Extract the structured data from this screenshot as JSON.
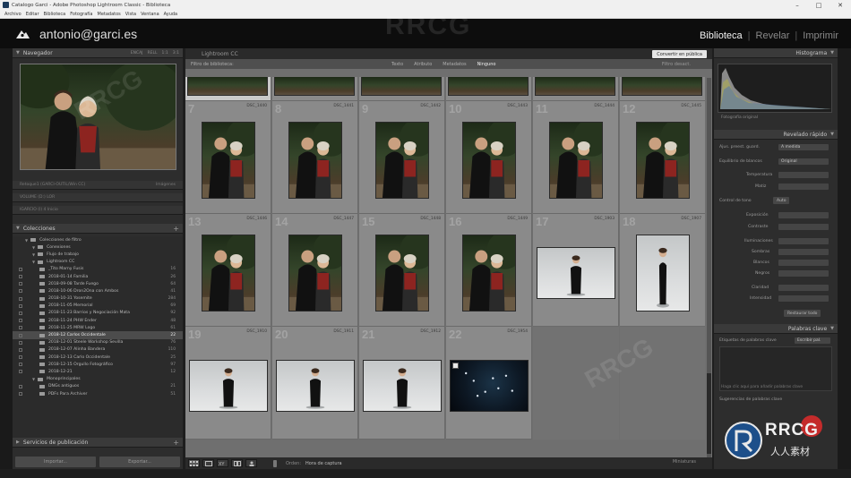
{
  "window": {
    "title": "Catalogo Garci - Adobe Photoshop Lightroom Classic - Biblioteca",
    "controls": [
      "minimize-icon",
      "maximize-icon",
      "close-icon"
    ]
  },
  "menu": [
    "Archivo",
    "Editar",
    "Biblioteca",
    "Fotografía",
    "Metadatos",
    "Vista",
    "Ventana",
    "Ayuda"
  ],
  "identity": {
    "user": "antonio@garci.es",
    "modules": [
      {
        "label": "Biblioteca",
        "active": true
      },
      {
        "label": "Revelar",
        "active": false
      },
      {
        "label": "Imprimir",
        "active": false
      }
    ]
  },
  "left_panel": {
    "navigator": {
      "title": "Navegador",
      "zoom_options": [
        "ENCAJ",
        "RELL",
        "1:1",
        "3:1"
      ]
    },
    "catalog_rows": [
      "Retoque1 (GARCI-OUTIL/Win CC)",
      "VOLUME (D:) LOR",
      "IGARCIO (I) 4 Inicio"
    ],
    "catalog_right": "Imágenes",
    "collections": {
      "title": "Colecciones",
      "items": [
        {
          "label": "Colecciones de filtro",
          "count": "",
          "indent": 1
        },
        {
          "label": "Conexiones",
          "count": "",
          "indent": 2
        },
        {
          "label": "Flujo de trabajo",
          "count": "",
          "indent": 2
        },
        {
          "label": "Lightroom CC",
          "count": "",
          "indent": 2
        },
        {
          "label": "_Tito Marny Fusis",
          "count": "16",
          "indent": 3
        },
        {
          "label": "2018-01-14 Familia",
          "count": "26",
          "indent": 3
        },
        {
          "label": "2018-09-08 Tarde Fuego",
          "count": "64",
          "indent": 3
        },
        {
          "label": "2018-10-06 Dron2Ona con Ambos",
          "count": "41",
          "indent": 3
        },
        {
          "label": "2018-10-31 Yosemite",
          "count": "284",
          "indent": 3
        },
        {
          "label": "2018-11-05 Memorial",
          "count": "69",
          "indent": 3
        },
        {
          "label": "2018-11-23 Barrios y Negociación Mata",
          "count": "92",
          "indent": 3
        },
        {
          "label": "2018-11-24 PHW Ender",
          "count": "48",
          "indent": 3
        },
        {
          "label": "2018-11-25 MRW Logo",
          "count": "61",
          "indent": 3
        },
        {
          "label": "2018-12 Carlos Occidentale",
          "count": "22",
          "indent": 3,
          "selected": true
        },
        {
          "label": "2018-12-01 Steele Workshop Sevilla",
          "count": "76",
          "indent": 3
        },
        {
          "label": "2018-12-07 Alinha Bandera",
          "count": "110",
          "indent": 3
        },
        {
          "label": "2018-12-13 Carlo Occidentale",
          "count": "25",
          "indent": 3
        },
        {
          "label": "2018-12-15 Orgullo Fotográfico",
          "count": "97",
          "indent": 3
        },
        {
          "label": "2018-12-21",
          "count": "12",
          "indent": 3
        },
        {
          "label": "Monoprincipales",
          "count": "",
          "indent": 2
        },
        {
          "label": "DNGs antiguos",
          "count": "21",
          "indent": 3
        },
        {
          "label": "PDFs Para Archiver",
          "count": "51",
          "indent": 3
        }
      ]
    },
    "publish_title": "Servicios de publicación",
    "buttons": {
      "import": "Importar...",
      "export": "Exportar..."
    }
  },
  "center": {
    "source": "Lightroom CC",
    "publish_button": "Convertir en pública",
    "filter_label": "Filtro de biblioteca:",
    "filter_options": [
      {
        "label": "Texto",
        "on": false
      },
      {
        "label": "Atributo",
        "on": false
      },
      {
        "label": "Metadatos",
        "on": false
      },
      {
        "label": "Ninguno",
        "on": true
      }
    ],
    "filter_off": "Filtro desact.",
    "toolbar": {
      "sort_label": "Orden:",
      "sort_value": "Hora de captura",
      "thumbs_label": "Miniaturas"
    },
    "cells": [
      {
        "num": "7",
        "idx": "",
        "file": "DSC_1440",
        "type": "outdoor",
        "orient": "portrait"
      },
      {
        "num": "8",
        "idx": "",
        "file": "DSC_1441",
        "type": "outdoor",
        "orient": "portrait"
      },
      {
        "num": "9",
        "idx": "",
        "file": "DSC_1442",
        "type": "outdoor",
        "orient": "portrait"
      },
      {
        "num": "10",
        "idx": "",
        "file": "DSC_1443",
        "type": "outdoor",
        "orient": "portrait"
      },
      {
        "num": "11",
        "idx": "",
        "file": "DSC_1444",
        "type": "outdoor",
        "orient": "portrait"
      },
      {
        "num": "12",
        "idx": "",
        "file": "DSC_1445",
        "type": "outdoor",
        "orient": "portrait"
      },
      {
        "num": "13",
        "idx": "",
        "file": "DSC_1446",
        "type": "outdoor",
        "orient": "portrait"
      },
      {
        "num": "14",
        "idx": "",
        "file": "DSC_1447",
        "type": "outdoor",
        "orient": "portrait"
      },
      {
        "num": "15",
        "idx": "",
        "file": "DSC_1448",
        "type": "outdoor",
        "orient": "portrait"
      },
      {
        "num": "16",
        "idx": "",
        "file": "DSC_1449",
        "type": "outdoor",
        "orient": "portrait"
      },
      {
        "num": "17",
        "idx": "",
        "file": "DSC_1903",
        "type": "studio",
        "orient": "landscape"
      },
      {
        "num": "18",
        "idx": "",
        "file": "DSC_1907",
        "type": "studio",
        "orient": "portrait"
      },
      {
        "num": "19",
        "idx": "",
        "file": "DSC_1910",
        "type": "studio",
        "orient": "landscape"
      },
      {
        "num": "20",
        "idx": "",
        "file": "DSC_1911",
        "type": "studio",
        "orient": "landscape"
      },
      {
        "num": "21",
        "idx": "",
        "file": "DSC_1912",
        "type": "studio",
        "orient": "landscape"
      },
      {
        "num": "22",
        "idx": "",
        "file": "DSC_1954",
        "type": "night",
        "orient": "landscape"
      }
    ]
  },
  "right_panel": {
    "histogram_title": "Histograma",
    "original_photo": "Fotografía original",
    "quick_dev": {
      "title": "Revelado rápido",
      "saved_preset_label": "Ajus. preest. guard.",
      "saved_preset_value": "A medida",
      "wb_label": "Equilibrio de blancos",
      "wb_value": "Original",
      "temp_label": "Temperatura",
      "tint_label": "Matiz",
      "tone_label": "Control de tono",
      "tone_auto": "Auto",
      "exposure_label": "Exposición",
      "contrast_label": "Contraste",
      "highlights_label": "Iluminaciones",
      "shadows_label": "Sombras",
      "whites_label": "Blancos",
      "blacks_label": "Negros",
      "clarity_label": "Claridad",
      "vibrance_label": "Intensidad",
      "reset_button": "Restaurar todo"
    },
    "keywords": {
      "title": "Palabras clave",
      "tags_label": "Etiquetas de palabras clave",
      "tags_value": "Escribir pal.",
      "hint": "Haga clic aquí para añadir palabras clave",
      "suggest_label": "Sugerencias de palabras clave"
    }
  },
  "watermark": {
    "brand": "RRCG",
    "cn": "人人素材"
  }
}
